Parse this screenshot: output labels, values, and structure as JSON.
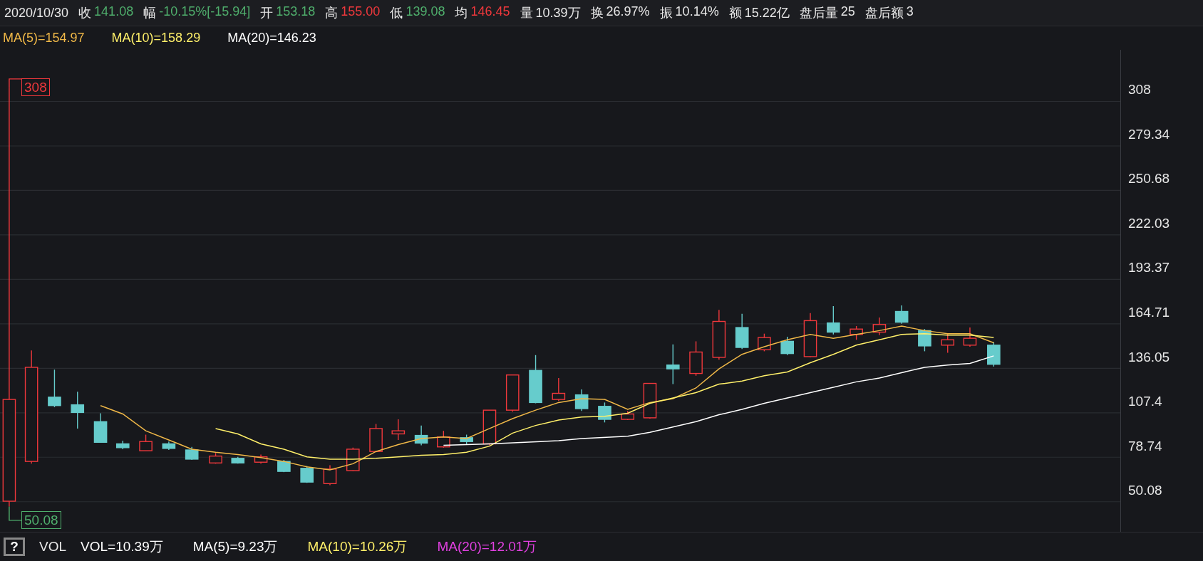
{
  "header": {
    "date": "2020/10/30",
    "stats": [
      {
        "label": "收",
        "value": "141.08",
        "color": "#4fae6c"
      },
      {
        "label": "幅",
        "value": "-10.15%[-15.94]",
        "color": "#4fae6c"
      },
      {
        "label": "开",
        "value": "153.18",
        "color": "#4fae6c"
      },
      {
        "label": "高",
        "value": "155.00",
        "color": "#f0383c"
      },
      {
        "label": "低",
        "value": "139.08",
        "color": "#4fae6c"
      },
      {
        "label": "均",
        "value": "146.45",
        "color": "#f0383c"
      },
      {
        "label": "量",
        "value": "10.39万",
        "color": "#e8e8e8"
      },
      {
        "label": "换",
        "value": "26.97%",
        "color": "#e8e8e8"
      },
      {
        "label": "振",
        "value": "10.14%",
        "color": "#e8e8e8"
      },
      {
        "label": "额",
        "value": "15.22亿",
        "color": "#e8e8e8"
      },
      {
        "label": "盘后量",
        "value": "25",
        "color": "#e8e8e8"
      },
      {
        "label": "盘后额",
        "value": "3",
        "color": "#e8e8e8"
      }
    ]
  },
  "price_legend": [
    {
      "text": "MA(5)=154.97",
      "color": "#f0b848"
    },
    {
      "text": "MA(10)=158.29",
      "color": "#fff06a"
    },
    {
      "text": "MA(20)=146.23",
      "color": "#ffffff"
    }
  ],
  "chart": {
    "max_label": "308",
    "min_label": "50.08",
    "y_axis": [
      "308",
      "279.34",
      "250.68",
      "222.03",
      "193.37",
      "164.71",
      "136.05",
      "107.4",
      "78.74",
      "50.08"
    ]
  },
  "volume_bar": {
    "help": "?",
    "title": "VOL",
    "legend": [
      {
        "text": "VOL=10.39万",
        "color": "#ffffff"
      },
      {
        "text": "MA(5)=9.23万",
        "color": "#ffffff"
      },
      {
        "text": "MA(10)=10.26万",
        "color": "#fff06a"
      },
      {
        "text": "MA(20)=12.01万",
        "color": "#e040e0"
      }
    ]
  }
}
